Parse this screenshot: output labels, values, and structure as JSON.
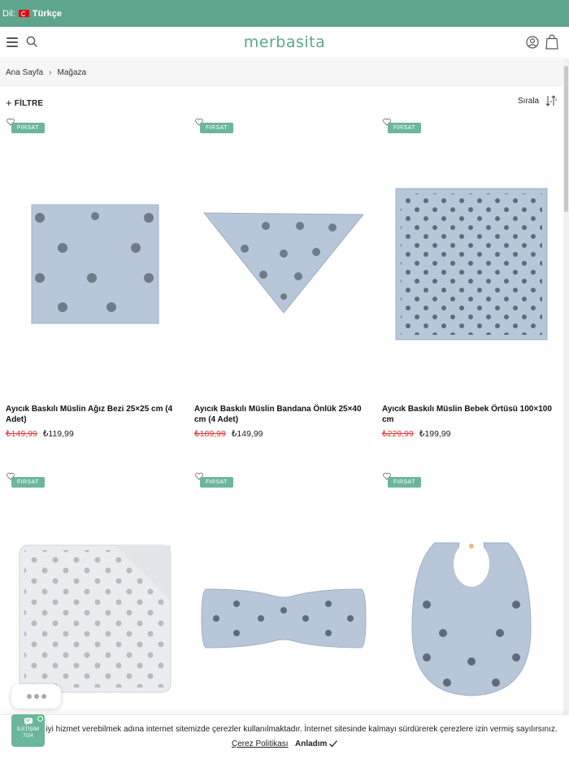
{
  "topbar": {
    "lang_label": "Dil:",
    "lang_value": "Türkçe",
    "flag_icon": "turkey-flag-icon",
    "bg_color": "#5fa58e"
  },
  "header": {
    "logo": "merbasita",
    "icons": [
      "menu-icon",
      "search-icon",
      "user-icon",
      "shopping-bag-icon"
    ]
  },
  "breadcrumb": {
    "items": [
      "Ana Sayfa",
      "Mağaza"
    ]
  },
  "filterbar": {
    "filter_label": "FİLTRE",
    "sort_label": "Sırala"
  },
  "products": [
    {
      "badge": "FIRSAT",
      "name": "Ayıcık Baskılı Müslin Ağız Bezi 25×25 cm (4 Adet)",
      "old_price": "₺149,99",
      "new_price": "₺119,99"
    },
    {
      "badge": "FIRSAT",
      "name": "Ayıcık Baskılı Müslin Bandana Önlük 25×40 cm (4 Adet)",
      "old_price": "₺189,99",
      "new_price": "₺149,99"
    },
    {
      "badge": "FIRSAT",
      "name": "Ayıcık Baskılı Müslin Bebek Örtüsü 100×100 cm",
      "old_price": "₺229,99",
      "new_price": "₺199,99"
    },
    {
      "badge": "FIRSAT",
      "name": "",
      "old_price": "",
      "new_price": ""
    },
    {
      "badge": "FIRSAT",
      "name": "",
      "old_price": "",
      "new_price": ""
    },
    {
      "badge": "FIRSAT",
      "name": "",
      "old_price": "",
      "new_price": ""
    }
  ],
  "contact": {
    "label": "İLETİŞİM",
    "hours": "7/24"
  },
  "cookie": {
    "message": "aha iyi hizmet verebilmek adına internet sitemizde çerezler kullanılmaktadır. İnternet sitesinde kalmayı sürdürerek çerezlere izin vermiş sayılırsınız.",
    "policy_label": "Çerez Politikası",
    "accept_label": "Anladım"
  },
  "colors": {
    "accent": "#6bb69d",
    "sale_price": "#e23b3b",
    "fabric": "#b7c6d8"
  }
}
